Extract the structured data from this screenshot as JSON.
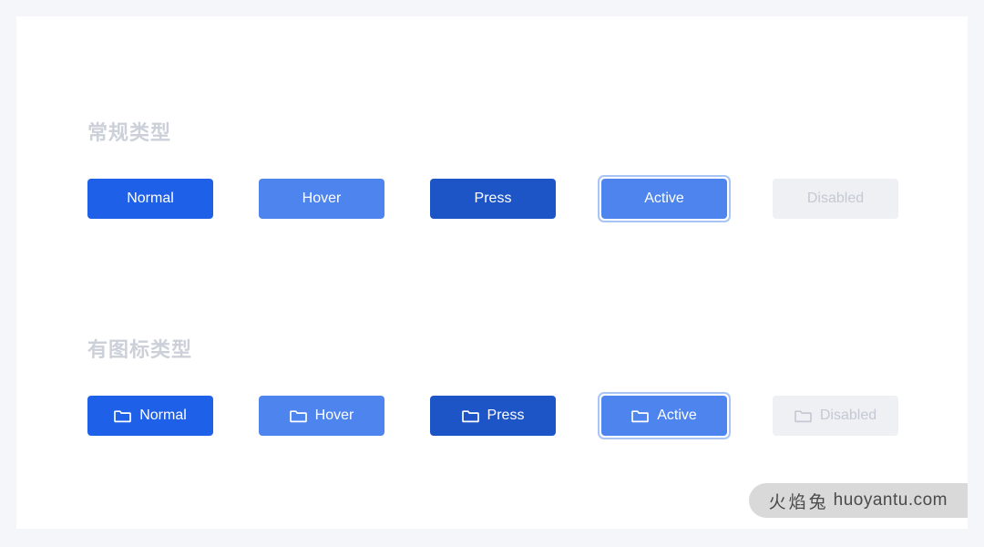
{
  "theme": {
    "page_background": "#f4f6fa",
    "canvas_background": "#ffffff",
    "heading_color": "#ccd0d9",
    "normal_blue": "#1f60e8",
    "hover_blue": "#4e84ee",
    "press_blue": "#1d55c6",
    "active_blue": "#4e84ee",
    "active_ring": "#a8c5f5",
    "disabled_bg": "#eef0f4",
    "disabled_text": "#c4c9d3",
    "button_text": "#ffffff"
  },
  "sections": [
    {
      "title": "常规类型",
      "buttons": [
        {
          "label": "Normal",
          "state": "normal",
          "icon": null
        },
        {
          "label": "Hover",
          "state": "hover",
          "icon": null
        },
        {
          "label": "Press",
          "state": "press",
          "icon": null
        },
        {
          "label": "Active",
          "state": "active",
          "icon": null
        },
        {
          "label": "Disabled",
          "state": "disabled",
          "icon": null
        }
      ]
    },
    {
      "title": "有图标类型",
      "buttons": [
        {
          "label": "Normal",
          "state": "normal",
          "icon": "folder-icon"
        },
        {
          "label": "Hover",
          "state": "hover",
          "icon": "folder-icon"
        },
        {
          "label": "Press",
          "state": "press",
          "icon": "folder-icon"
        },
        {
          "label": "Active",
          "state": "active",
          "icon": "folder-icon"
        },
        {
          "label": "Disabled",
          "state": "disabled",
          "icon": "folder-icon"
        }
      ]
    }
  ],
  "watermark": {
    "brand_cn": "火焰兔",
    "domain": "huoyantu.com"
  }
}
